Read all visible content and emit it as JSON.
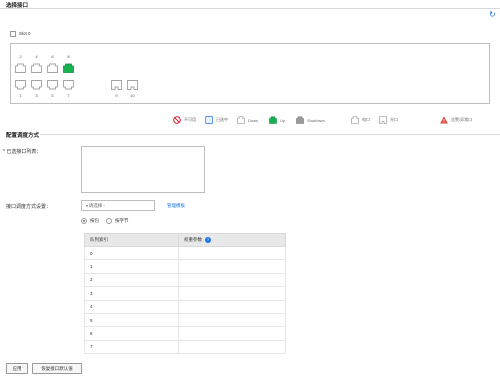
{
  "section1": {
    "title": "选择接口"
  },
  "slot": {
    "label": "Slot 0"
  },
  "ports": {
    "top_labels": [
      "2",
      "4",
      "6",
      "8"
    ],
    "bottom_labels": [
      "1",
      "3",
      "5",
      "7",
      "9",
      "10"
    ]
  },
  "legend": [
    {
      "icon": "not-present-icon",
      "label": "不可用"
    },
    {
      "icon": "selected-port-icon",
      "label": "已选中"
    },
    {
      "icon": "down-port-icon",
      "label": "Down"
    },
    {
      "icon": "up-port-icon",
      "label": "Up"
    },
    {
      "icon": "shutdown-port-icon",
      "label": "Shutdown"
    },
    {
      "icon": "electric-port-icon",
      "label": "电口"
    },
    {
      "icon": "optical-port-icon",
      "label": "光口"
    },
    {
      "icon": "warning-icon",
      "label": "告警/异常口"
    }
  ],
  "section2": {
    "title": "配置调度方式"
  },
  "form": {
    "selected_list_label": "* 已选接口列表：",
    "schedule_label": "接口调度方式设置：",
    "select_placeholder": "- 请选择 -",
    "manage_link": "管理模板",
    "radio_packet": "按包",
    "radio_byte": "按字节"
  },
  "table": {
    "col1": "队列索引",
    "col2": "权重参数",
    "rows": [
      "0",
      "1",
      "2",
      "3",
      "4",
      "5",
      "6",
      "7"
    ]
  },
  "buttons": {
    "apply": "应用",
    "restore": "恢复接口默认值"
  },
  "colors": {
    "accent": "#1a73e8",
    "up_green": "#16b150"
  }
}
